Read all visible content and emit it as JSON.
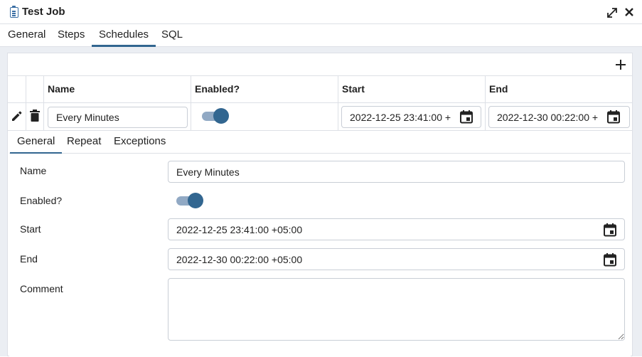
{
  "window": {
    "title": "Test Job"
  },
  "top_tabs": [
    "General",
    "Steps",
    "Schedules",
    "SQL"
  ],
  "active_top_tab": "Schedules",
  "grid": {
    "columns": [
      "Name",
      "Enabled?",
      "Start",
      "End"
    ],
    "rows": [
      {
        "name": "Every Minutes",
        "enabled": true,
        "start": "2022-12-25 23:41:00 +",
        "end": "2022-12-30 00:22:00 +"
      }
    ]
  },
  "sub_tabs": [
    "General",
    "Repeat",
    "Exceptions"
  ],
  "active_sub_tab": "General",
  "form": {
    "name_label": "Name",
    "name_value": "Every Minutes",
    "enabled_label": "Enabled?",
    "enabled_value": true,
    "start_label": "Start",
    "start_value": "2022-12-25 23:41:00 +05:00",
    "end_label": "End",
    "end_value": "2022-12-30 00:22:00 +05:00",
    "comment_label": "Comment",
    "comment_value": ""
  },
  "icons": {
    "app": "clipboard-icon",
    "expand": "expand-icon",
    "close": "close-icon",
    "add": "plus-icon",
    "edit": "pencil-icon",
    "delete": "trash-icon",
    "calendar": "calendar-icon"
  },
  "colors": {
    "accent": "#326690",
    "toggle_track": "#91a9c4",
    "panel_bg": "#ebeef3",
    "border": "#dde0e6"
  }
}
